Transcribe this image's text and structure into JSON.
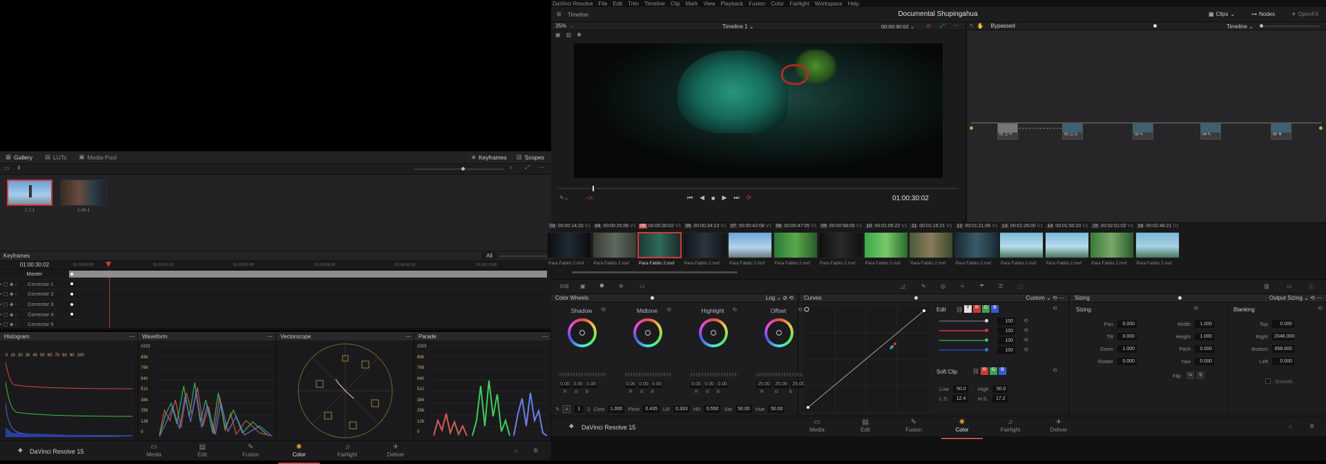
{
  "left": {
    "gallery_tabs": [
      {
        "label": "Gallery",
        "icon": "gallery-icon"
      },
      {
        "label": "LUTs",
        "icon": "luts-icon"
      },
      {
        "label": "Media Pool",
        "icon": "media-pool-icon"
      }
    ],
    "gallery_right": {
      "keyframes": "Keyframes",
      "scopes": "Scopes"
    },
    "stills": [
      {
        "label": "1.7.1"
      },
      {
        "label": "1.46.1"
      }
    ],
    "keyframes": {
      "title": "Keyframes",
      "filter": "All",
      "timecode": "01:00:30:02",
      "ruler": [
        "01:00:00:00",
        "01:01:02:16",
        "01:02:05:08",
        "01:03:08:00",
        "01:04:10:16",
        "01:05:13:08"
      ],
      "rows": [
        "Master",
        "Corrector 1",
        "Corrector 2",
        "Corrector 3",
        "Corrector 4",
        "Corrector 5"
      ]
    },
    "scopes": {
      "histogram": "Histogram",
      "histogram_ticks": [
        "0",
        "10",
        "20",
        "30",
        "40",
        "50",
        "60",
        "70",
        "80",
        "90",
        "100"
      ],
      "waveform": "Waveform",
      "vectorscope": "Vectorscope",
      "parade": "Parade",
      "levels": [
        "1023",
        "896",
        "768",
        "640",
        "512",
        "384",
        "256",
        "128",
        "0"
      ]
    },
    "app_name": "DaVinci Resolve 15"
  },
  "nav": [
    {
      "label": "Media",
      "icon": "media-icon"
    },
    {
      "label": "Edit",
      "icon": "edit-icon"
    },
    {
      "label": "Fusion",
      "icon": "fusion-icon"
    },
    {
      "label": "Color",
      "icon": "color-icon",
      "active": true
    },
    {
      "label": "Fairlight",
      "icon": "fairlight-icon"
    },
    {
      "label": "Deliver",
      "icon": "deliver-icon"
    }
  ],
  "right": {
    "menu": [
      "DaVinci Resolve",
      "File",
      "Edit",
      "Trim",
      "Timeline",
      "Clip",
      "Mark",
      "View",
      "Playback",
      "Fusion",
      "Color",
      "Fairlight",
      "Workspace",
      "Help"
    ],
    "header": {
      "left_label": "Timeline",
      "project_title": "Documental Shupingahua",
      "clips": "Clips",
      "nodes": "Nodes",
      "openfx": "OpenFX"
    },
    "viewer": {
      "zoom": "35%",
      "timeline_name": "Timeline 1",
      "timecode_top": "00:00:30:02",
      "timecode": "01:00:30:02"
    },
    "node_graph": {
      "bypassed": "Bypassed",
      "mode": "Timeline",
      "nodes": [
        "01",
        "03",
        "02",
        "04",
        "05"
      ]
    },
    "clips": [
      {
        "num": "03",
        "tc": "00:00:14:20",
        "track": "V1",
        "name": "Para Fabito 2.mxf"
      },
      {
        "num": "04",
        "tc": "00:00:25:06",
        "track": "V1",
        "name": "Para Fabito 2.mxf"
      },
      {
        "num": "05",
        "tc": "00:00:30:02",
        "track": "V1",
        "name": "Para Fabito 2.mxf",
        "selected": true
      },
      {
        "num": "06",
        "tc": "00:00:34:13",
        "track": "V1",
        "name": "Para Fabito 2.mxf"
      },
      {
        "num": "07",
        "tc": "00:00:42:08",
        "track": "V1",
        "name": "Para Fabito 2.mxf"
      },
      {
        "num": "08",
        "tc": "00:00:47:05",
        "track": "V1",
        "name": "Para Fabito 2.mxf"
      },
      {
        "num": "09",
        "tc": "00:00:58:05",
        "track": "V1",
        "name": "Para Fabito 2.mxf"
      },
      {
        "num": "10",
        "tc": "00:01:05:22",
        "track": "V1",
        "name": "Para Fabito 2.mxf"
      },
      {
        "num": "11",
        "tc": "00:01:16:21",
        "track": "V1",
        "name": "Para Fabito 2.mxf"
      },
      {
        "num": "12",
        "tc": "00:01:21:06",
        "track": "V1",
        "name": "Para Fabito 2.mxf"
      },
      {
        "num": "13",
        "tc": "00:01:26:00",
        "track": "V1",
        "name": "Para Fabito 2.mxf"
      },
      {
        "num": "14",
        "tc": "00:01:50:20",
        "track": "V1",
        "name": "Para Fabito 2.mxf"
      },
      {
        "num": "15",
        "tc": "00:02:01:02",
        "track": "V1",
        "name": "Para Fabito 2.mxf"
      },
      {
        "num": "16",
        "tc": "00:02:48:21",
        "track": "V1",
        "name": "Para Fabito 2.mxf"
      }
    ],
    "color_wheels": {
      "title": "Color Wheels",
      "mode": "Log",
      "wheels": [
        {
          "label": "Shadow",
          "values": [
            "0.00",
            "0.00",
            "0.00"
          ],
          "channels": [
            "R",
            "G",
            "B"
          ]
        },
        {
          "label": "Midtone",
          "values": [
            "0.00",
            "0.00",
            "0.00"
          ],
          "channels": [
            "R",
            "G",
            "B"
          ]
        },
        {
          "label": "Highlight",
          "values": [
            "0.00",
            "0.00",
            "0.00"
          ],
          "channels": [
            "R",
            "G",
            "B"
          ]
        },
        {
          "label": "Offset",
          "values": [
            "25.00",
            "25.00",
            "25.00"
          ],
          "channels": [
            "R",
            "G",
            "B"
          ]
        }
      ],
      "page1": "1",
      "page2": "2",
      "params": [
        {
          "label": "Cont",
          "value": "1.000"
        },
        {
          "label": "Pivot",
          "value": "0.435"
        },
        {
          "label": "LR",
          "value": "0.333"
        },
        {
          "label": "HR",
          "value": "0.550"
        },
        {
          "label": "Sat",
          "value": "50.00"
        },
        {
          "label": "Hue",
          "value": "50.00"
        }
      ]
    },
    "curves": {
      "title": "Curves",
      "mode": "Custom",
      "edit_label": "Edit",
      "channels": [
        "Y",
        "R",
        "G",
        "B"
      ],
      "intensity": [
        "100",
        "100",
        "100",
        "100"
      ],
      "soft_clip": "Soft Clip",
      "low_label": "Low",
      "low": "50.0",
      "high_label": "High",
      "high": "50.0",
      "ls_label": "L.S.",
      "ls": "12.4",
      "hs_label": "H.S.",
      "hs": "17.2"
    },
    "sizing": {
      "title": "Sizing",
      "mode": "Output Sizing",
      "section": "Sizing",
      "left_fields": [
        {
          "label": "Pan",
          "value": "0.000"
        },
        {
          "label": "Tilt",
          "value": "0.000"
        },
        {
          "label": "Zoom",
          "value": "1.000"
        },
        {
          "label": "Rotate",
          "value": "0.000"
        }
      ],
      "right_fields": [
        {
          "label": "Width",
          "value": "1.000"
        },
        {
          "label": "Height",
          "value": "1.000"
        },
        {
          "label": "Pitch",
          "value": "0.000"
        },
        {
          "label": "Yaw",
          "value": "0.000"
        }
      ],
      "flip": "Flip",
      "blanking": "Blanking",
      "blank_fields": [
        {
          "label": "Top",
          "value": "0.000"
        },
        {
          "label": "Right",
          "value": "2048.000"
        },
        {
          "label": "Bottom",
          "value": "858.000"
        },
        {
          "label": "Left",
          "value": "0.000"
        }
      ],
      "smooth": "Smooth"
    },
    "app_name": "DaVinci Resolve 15"
  }
}
